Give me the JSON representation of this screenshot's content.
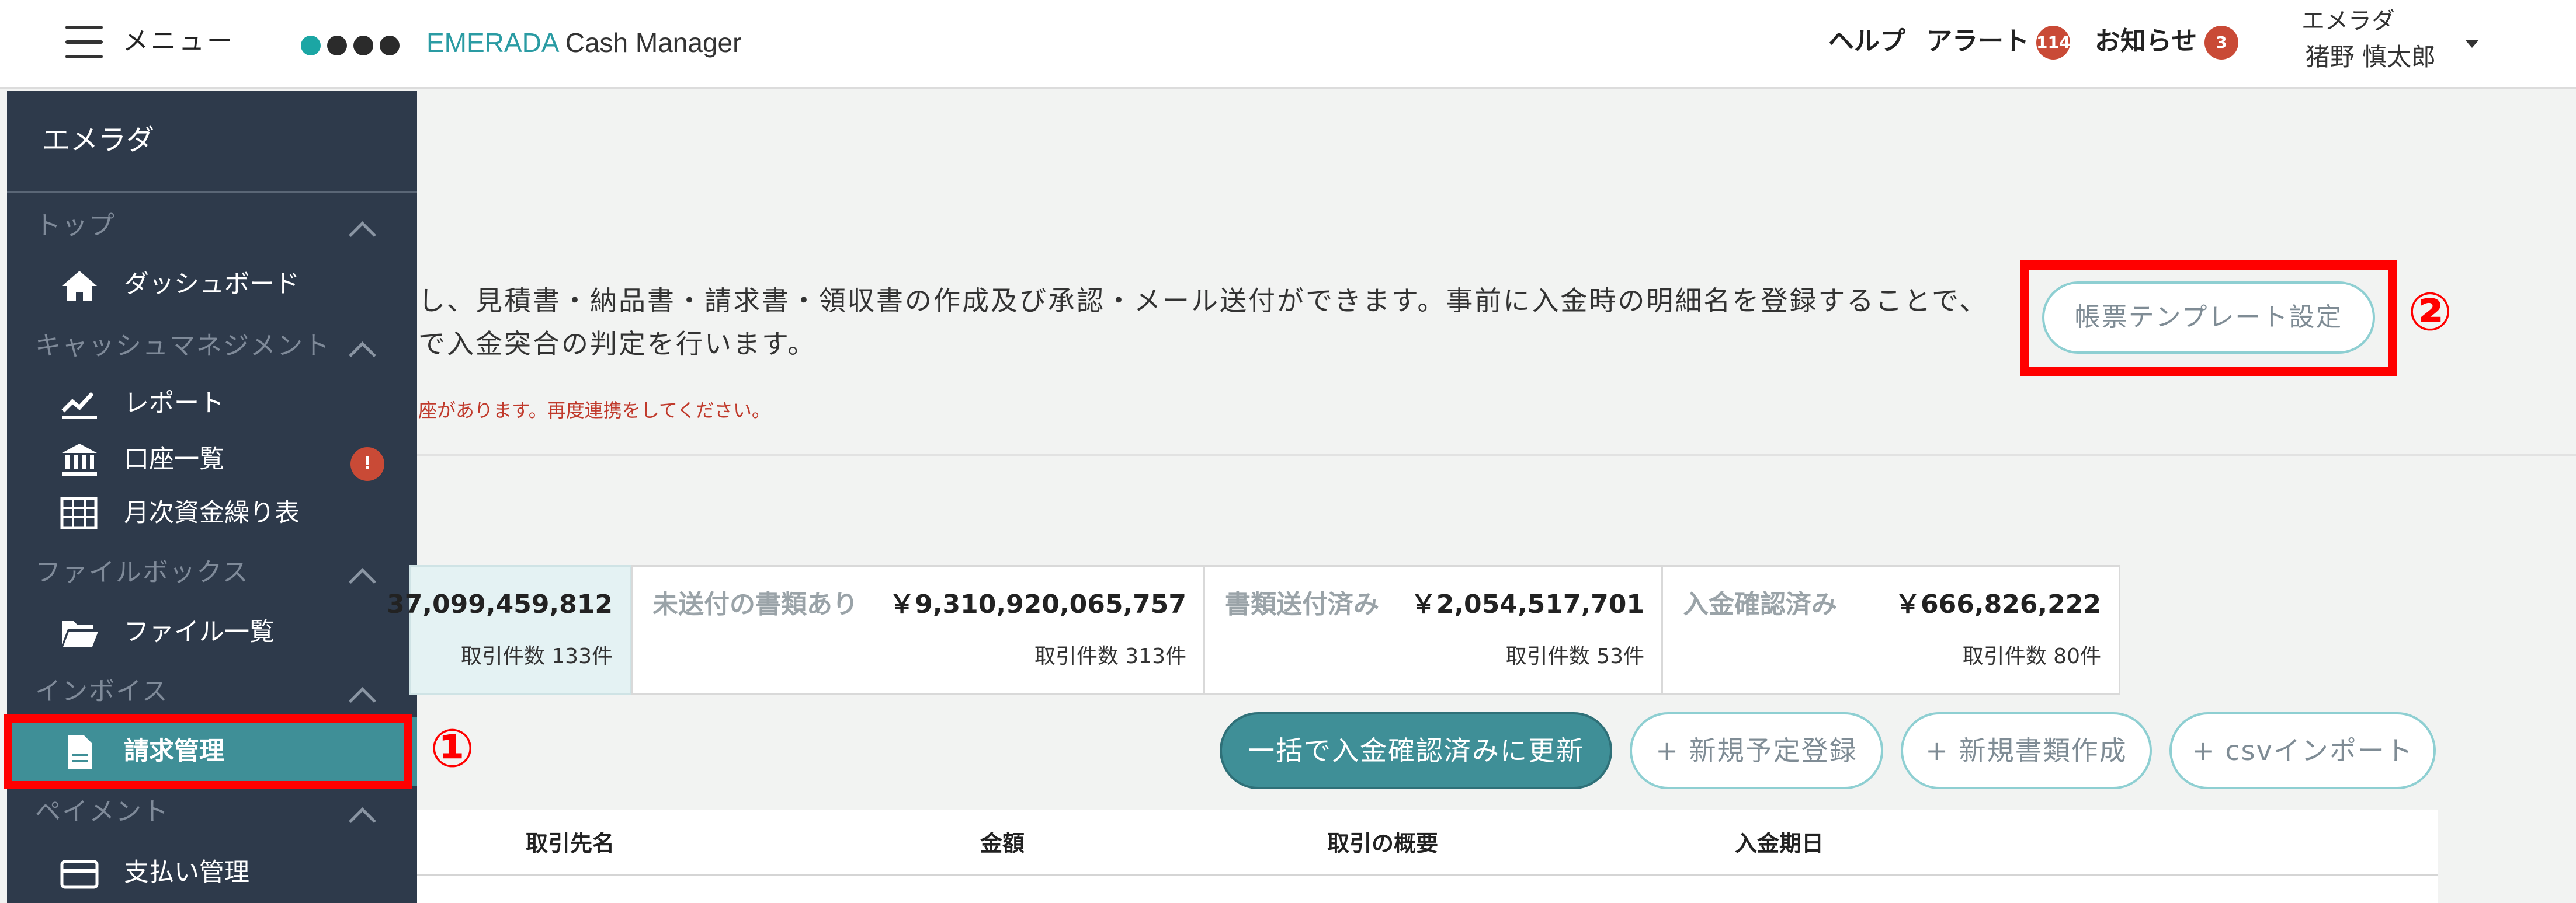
{
  "header": {
    "menu_label": "メニュー",
    "brand_em": "EMERADA",
    "brand_rest": " Cash Manager",
    "help": "ヘルプ",
    "alert": "アラート",
    "alert_count": "114",
    "notice": "お知らせ",
    "notice_count": "3",
    "user_company": "エメラダ",
    "user_name": "猪野 慎太郎"
  },
  "sidebar": {
    "company": "エメラダ",
    "sections": [
      {
        "label": "トップ",
        "items": [
          {
            "label": "ダッシュボード",
            "icon": "home-icon"
          }
        ]
      },
      {
        "label": "キャッシュマネジメント",
        "items": [
          {
            "label": "レポート",
            "icon": "chart-icon"
          },
          {
            "label": "口座一覧",
            "icon": "bank-icon",
            "badge": "!"
          },
          {
            "label": "月次資金繰り表",
            "icon": "table-icon"
          }
        ]
      },
      {
        "label": "ファイルボックス",
        "items": [
          {
            "label": "ファイル一覧",
            "icon": "folder-icon"
          }
        ]
      },
      {
        "label": "インボイス",
        "items": [
          {
            "label": "請求管理",
            "icon": "document-icon",
            "active": true
          }
        ]
      },
      {
        "label": "ペイメント",
        "items": [
          {
            "label": "支払い管理",
            "icon": "card-icon"
          }
        ]
      }
    ]
  },
  "annotations": {
    "one": "①",
    "two": "②"
  },
  "main": {
    "description_line1": "し、見積書・納品書・請求書・領収書の作成及び承認・メール送付ができます。事前に入金時の明細名を登録することで、",
    "description_line2": "で入金突合の判定を行います。",
    "warning": "座があります。再度連携をしてください。",
    "template_button": "帳票テンプレート設定"
  },
  "tabs": [
    {
      "label": "",
      "amount": "37,099,459,812",
      "count": "取引件数 133件",
      "active": true
    },
    {
      "label": "未送付の書類あり",
      "amount": "￥9,310,920,065,757",
      "count": "取引件数 313件"
    },
    {
      "label": "書類送付済み",
      "amount": "￥2,054,517,701",
      "count": "取引件数 53件"
    },
    {
      "label": "入金確認済み",
      "amount": "￥666,826,222",
      "count": "取引件数 80件"
    }
  ],
  "actions": {
    "bulk_update": "一括で入金確認済みに更新",
    "new_plan": "+ 新規予定登録",
    "new_document": "+ 新規書類作成",
    "csv_import": "+ csvインポート"
  },
  "table": {
    "columns": [
      "取引先名",
      "金額",
      "取引の概要",
      "入金期日"
    ]
  },
  "colors": {
    "sidebar_bg": "#2e3a4b",
    "accent": "#3f8f97",
    "highlight": "#ff0000",
    "badge": "#c94a36"
  }
}
